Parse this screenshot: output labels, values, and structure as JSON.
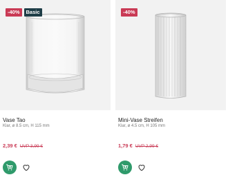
{
  "products": [
    {
      "badges": [
        "-40%",
        "Basic"
      ],
      "title": "Vase Tao",
      "subtitle": "Klar, ø 8.5 cm, H 115 mm",
      "price": "2,39 €",
      "uvp": "UVP 3,99 €",
      "cart_icon": "cart-plus-icon",
      "wishlist_icon": "heart-icon"
    },
    {
      "badges": [
        "-40%"
      ],
      "title": "Mini-Vase Streifen",
      "subtitle": "Klar, ø 4.5 cm, H 105 mm",
      "price": "1,79 €",
      "uvp": "UVP 2,99 €",
      "cart_icon": "cart-plus-icon",
      "wishlist_icon": "heart-icon"
    }
  ],
  "colors": {
    "sale": "#c93a55",
    "basic": "#1e3d47",
    "cart": "#2f9a6b",
    "image_bg": "#f2f2f2"
  }
}
